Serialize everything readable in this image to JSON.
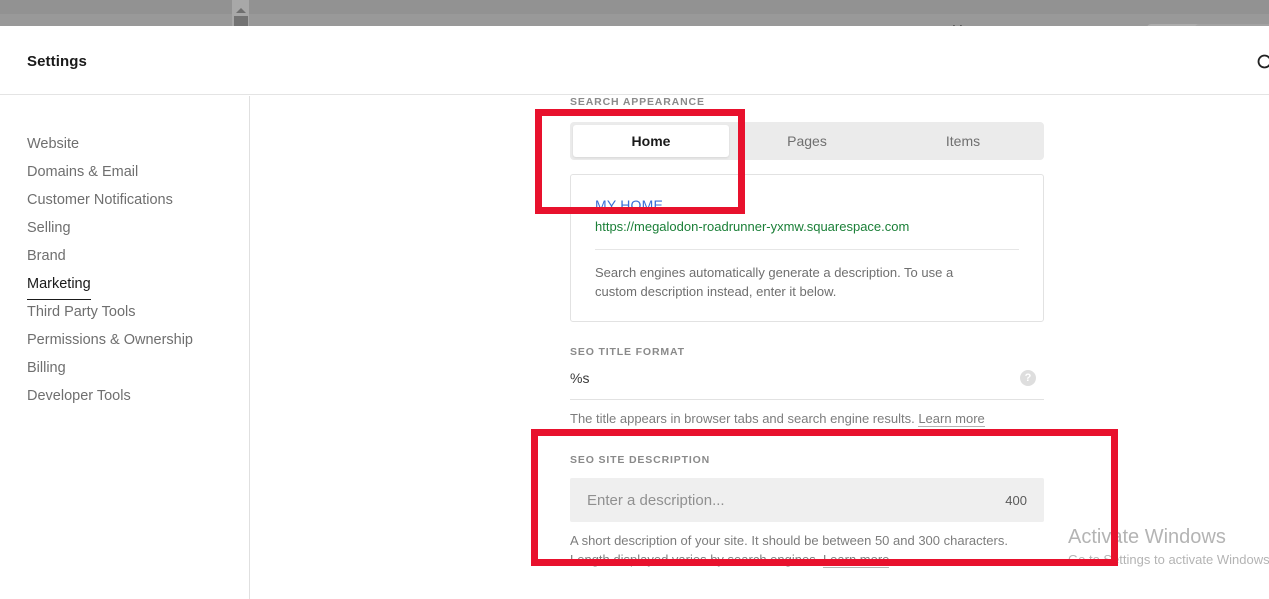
{
  "browser_chrome": {
    "partial_glyph": "H",
    "scrollbar_name": "vertical-scrollbar"
  },
  "header": {
    "title": "Settings",
    "search_icon": "search-icon"
  },
  "sidebar": {
    "items": [
      {
        "label": "Website",
        "active": false
      },
      {
        "label": "Domains & Email",
        "active": false
      },
      {
        "label": "Customer Notifications",
        "active": false
      },
      {
        "label": "Selling",
        "active": false
      },
      {
        "label": "Brand",
        "active": false
      },
      {
        "label": "Marketing",
        "active": true
      },
      {
        "label": "Third Party Tools",
        "active": false
      },
      {
        "label": "Permissions & Ownership",
        "active": false
      },
      {
        "label": "Billing",
        "active": false
      },
      {
        "label": "Developer Tools",
        "active": false
      }
    ]
  },
  "main": {
    "search_appearance": {
      "label": "SEARCH APPEARANCE",
      "tabs": [
        {
          "label": "Home",
          "active": true
        },
        {
          "label": "Pages",
          "active": false
        },
        {
          "label": "Items",
          "active": false
        }
      ]
    },
    "preview": {
      "title": "MY HOME",
      "url": "https://megalodon-roadrunner-yxmw.squarespace.com",
      "description": "Search engines automatically generate a description. To use a custom description instead, enter it below.",
      "title_color": "#3a6fd8",
      "url_color": "#1a7f37"
    },
    "seo_title_format": {
      "label": "SEO TITLE FORMAT",
      "value": "%s",
      "help_icon_glyph": "?",
      "help_text": "The title appears in browser tabs and search engine results. ",
      "learn_more": "Learn more"
    },
    "seo_site_description": {
      "label": "SEO SITE DESCRIPTION",
      "placeholder": "Enter a description...",
      "value": "",
      "counter": "400",
      "help_text": "A short description of your site. It should be between 50 and 300 characters. Length displayed varies by search engines. ",
      "learn_more": "Learn more"
    }
  },
  "annotations": {
    "color": "#e8112d",
    "boxes": [
      {
        "name": "search-appearance-highlight"
      },
      {
        "name": "seo-site-description-highlight"
      }
    ]
  },
  "watermark": {
    "title": "Activate Windows",
    "subtitle": "Go to Settings to activate Windows."
  }
}
